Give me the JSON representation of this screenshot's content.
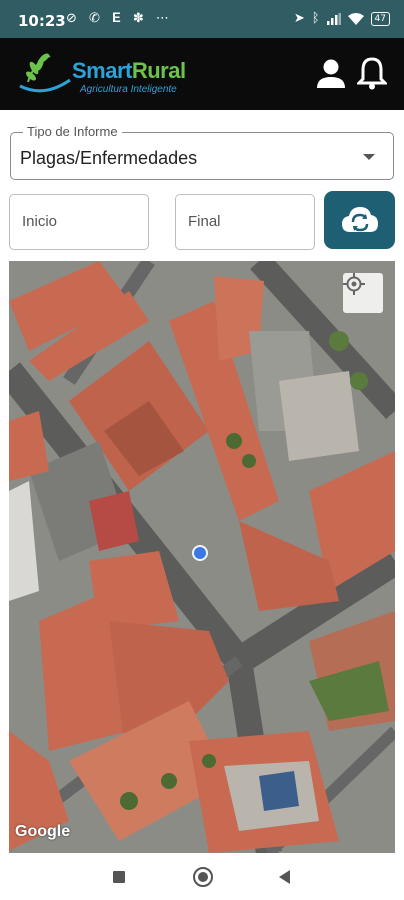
{
  "status_bar": {
    "time": "10:23",
    "left_icons": "⊘ ✆ 𝐄 ✽ ⋯",
    "battery": "47"
  },
  "app": {
    "title_part1": "Smart",
    "title_part2": "Rural",
    "subtitle": "Agricultura Inteligente",
    "brand_color": "#2ba3d8",
    "accent_color": "#6cc24a"
  },
  "report_type": {
    "label": "Tipo de Informe",
    "value": "Plagas/Enfermedades"
  },
  "dates": {
    "start_placeholder": "Inicio",
    "end_placeholder": "Final"
  },
  "map": {
    "attribution": "Google",
    "location_dot_color": "#3b78e7"
  },
  "colors": {
    "status_bar": "#2f5d63",
    "app_bar": "#0b0b0b",
    "refresh_button": "#1f5f74"
  }
}
